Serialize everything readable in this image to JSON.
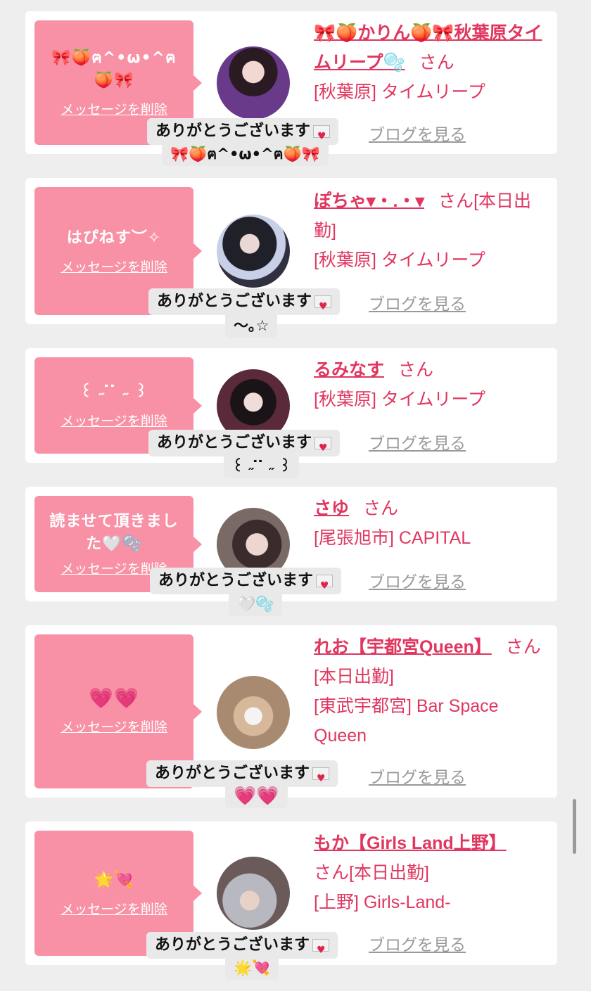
{
  "delete_label": "メッセージを削除",
  "blog_label": "ブログを見る",
  "thanks_label": "ありがとうございます",
  "items": [
    {
      "message": "🎀🍑ฅ^•ω•^ฅ🍑🎀",
      "name": "🎀🍑かりん🍑🎀秋葉原タイムリープ🫧",
      "san": "さん",
      "status": "",
      "shop": "[秋葉原] タイムリープ",
      "reply": "🎀🍑ฅ^•ω•^ฅ🍑🎀"
    },
    {
      "message": "はぴねす︶✧︎",
      "name": "ぽちゃ▾・.・▾",
      "san": "さん",
      "status": "[本日出勤]",
      "shop": "[秋葉原] タイムリープ",
      "reply": "〜｡☆"
    },
    {
      "message": "꒰ ˶ ̇ ̇ ˶ ꒱",
      "name": "るみなす",
      "san": "さん",
      "status": "",
      "shop": "[秋葉原] タイムリープ",
      "reply": "꒰ ˶ ̇ ̇ ˶ ꒱"
    },
    {
      "message": "読ませて頂きました🤍🫧",
      "name": "さゆ",
      "san": "さん",
      "status": "",
      "shop": "[尾張旭市] CAPITAL",
      "reply": "🤍🫧"
    },
    {
      "message": "💗💗",
      "name": "れお【宇都宮Queen】",
      "san": "さん",
      "status": "[本日出勤]",
      "shop": "[東武宇都宮] Bar Space Queen",
      "reply": "💗💗"
    },
    {
      "message": "🌟💘",
      "name": "もか【Girls Land上野】",
      "san": "さん",
      "status": "[本日出勤]",
      "shop": "[上野] Girls-Land-",
      "reply": "🌟💘"
    }
  ],
  "avatar_colors": [
    "#5a3a7a",
    "#3a3a4a",
    "#2a2028",
    "#5a4a4a",
    "#b89a88",
    "#8a8a90"
  ]
}
